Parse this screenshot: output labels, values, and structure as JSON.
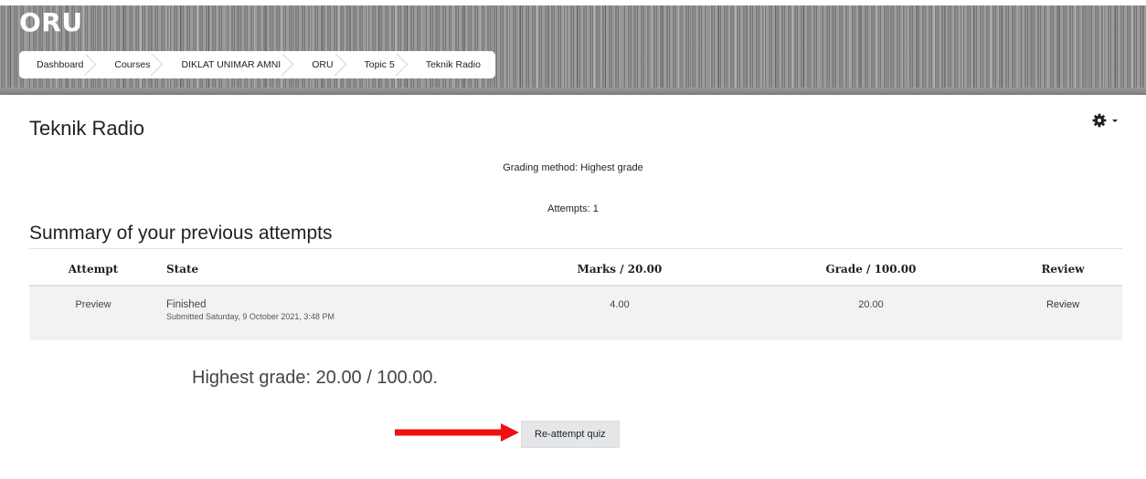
{
  "header": {
    "site_name": "ORU",
    "breadcrumbs": [
      {
        "label": "Dashboard"
      },
      {
        "label": "Courses"
      },
      {
        "label": "DIKLAT UNIMAR AMNI"
      },
      {
        "label": "ORU"
      },
      {
        "label": "Topic 5"
      },
      {
        "label": "Teknik Radio"
      }
    ]
  },
  "page": {
    "title": "Teknik Radio",
    "settings_icon": "gear-icon",
    "grading_method": "Grading method: Highest grade",
    "attempts_count": "Attempts: 1"
  },
  "summary": {
    "title": "Summary of your previous attempts",
    "columns": [
      "Attempt",
      "State",
      "Marks / 20.00",
      "Grade / 100.00",
      "Review"
    ],
    "rows": [
      {
        "attempt": "Preview",
        "state": "Finished",
        "submitted": "Submitted Saturday, 9 October 2021, 3:48 PM",
        "marks": "4.00",
        "grade": "20.00",
        "review": "Review"
      }
    ]
  },
  "result": {
    "highest_grade": "Highest grade: 20.00 / 100.00."
  },
  "actions": {
    "reattempt_label": "Re-attempt quiz"
  },
  "colors": {
    "annotation_arrow": "#ee1111",
    "row_background": "#f2f2f2",
    "button_background": "#e4e6e8"
  }
}
